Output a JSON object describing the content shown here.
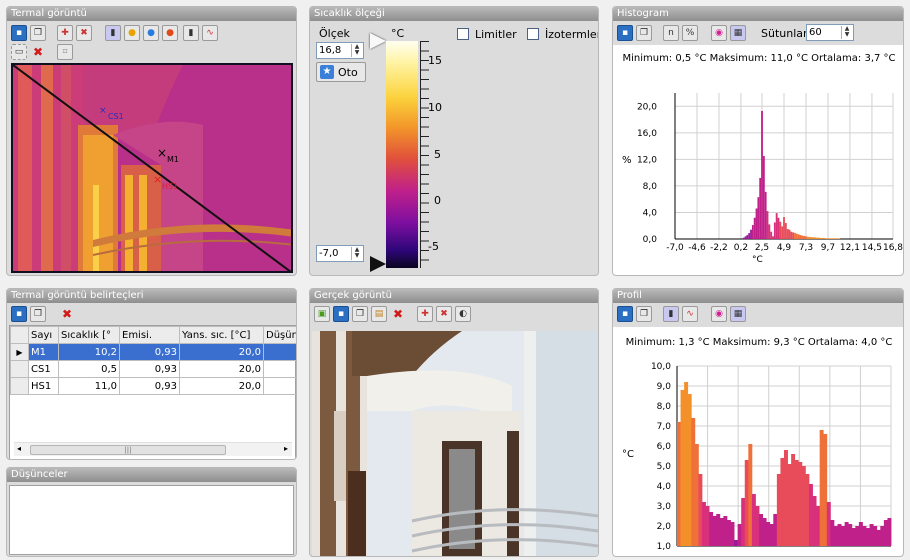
{
  "thermal": {
    "title": "Termal görüntü",
    "markers": [
      {
        "label": "CS1"
      },
      {
        "label": "M1"
      },
      {
        "label": "HS1"
      }
    ]
  },
  "scale": {
    "title": "Sıcaklık ölçeği",
    "olcek_label": "Ölçek",
    "max_value": "16,8",
    "min_value": "-7,0",
    "oto_label": "Oto",
    "unit": "°C",
    "limits_label": "Limitler",
    "isotherms_label": "İzotermler",
    "ticks": [
      "15",
      "10",
      "5",
      "0",
      "-5"
    ]
  },
  "histogram": {
    "title": "Histogram",
    "columns_label": "Sütunlar",
    "columns_value": "60",
    "stats": "Minimum: 0,5 °C Maksimum: 11,0 °C Ortalama: 3,7 °C",
    "ylabel": "%",
    "xlabel": "°C",
    "yticks": [
      "20,0",
      "16,0",
      "12,0",
      "8,0",
      "4,0",
      "0,0"
    ],
    "xticks": [
      "-7,0",
      "-4,6",
      "-2,2",
      "0,2",
      "2,5",
      "4,9",
      "7,3",
      "9,7",
      "12,1",
      "14,5",
      "16,8"
    ]
  },
  "markers_table": {
    "title": "Termal görüntü belirteçleri",
    "columns": [
      "Sayı",
      "Sıcaklık [°",
      "Emisi.",
      "Yans. sıc. [°C]",
      "Düşün"
    ],
    "rows": [
      [
        "M1",
        "10,2",
        "0,93",
        "20,0"
      ],
      [
        "CS1",
        "0,5",
        "0,93",
        "20,0"
      ],
      [
        "HS1",
        "11,0",
        "0,93",
        "20,0"
      ]
    ]
  },
  "notes": {
    "title": "Düşünceler",
    "text": ""
  },
  "real": {
    "title": "Gerçek görüntü"
  },
  "profile": {
    "title": "Profil",
    "stats": "Minimum: 1,3 °C Maksimum: 9,3 °C Ortalama: 4,0 °C",
    "ylabel": "°C",
    "yticks": [
      "10,0",
      "9,0",
      "8,0",
      "7,0",
      "6,0",
      "5,0",
      "4,0",
      "3,0",
      "2,0",
      "1,0"
    ]
  },
  "chart_data": [
    {
      "type": "bar",
      "title": "Histogram",
      "xlabel": "°C",
      "ylabel": "%",
      "xlim": [
        -7.0,
        16.8
      ],
      "ylim": [
        0,
        22
      ],
      "x": [
        0.5,
        0.7,
        0.9,
        1.1,
        1.3,
        1.5,
        1.7,
        1.9,
        2.1,
        2.3,
        2.5,
        2.7,
        2.9,
        3.1,
        3.3,
        3.5,
        3.7,
        3.9,
        4.1,
        4.3,
        4.5,
        4.7,
        4.9,
        5.1,
        5.3,
        5.5,
        5.7,
        5.9,
        6.1,
        6.3,
        6.5,
        6.7,
        6.9,
        7.1,
        7.3,
        7.5,
        7.7,
        7.9,
        8.1,
        8.3,
        8.5,
        8.7,
        8.9,
        9.1,
        9.3,
        9.5,
        9.7,
        9.9,
        10.1,
        10.3,
        10.5,
        10.7,
        10.9
      ],
      "values": [
        0.2,
        0.4,
        0.6,
        0.9,
        1.4,
        2.1,
        3.2,
        4.6,
        6.3,
        9.2,
        19.3,
        12.5,
        7.1,
        4.2,
        2.2,
        1.1,
        0.4,
        2.5,
        3.9,
        3.2,
        2.6,
        1.9,
        3.3,
        2.4,
        1.5,
        1.4,
        1.1,
        1.0,
        0.9,
        0.8,
        0.7,
        0.6,
        0.5,
        0.45,
        0.4,
        0.35,
        0.3,
        0.3,
        0.25,
        0.25,
        0.2,
        0.2,
        0.15,
        0.15,
        0.15,
        0.1,
        0.1,
        0.1,
        0.1,
        0.1,
        0.1,
        0.1,
        0.1
      ]
    },
    {
      "type": "area",
      "title": "Profil",
      "ylabel": "°C",
      "ylim": [
        1.0,
        10.0
      ],
      "values": [
        7.2,
        8.8,
        9.2,
        8.6,
        7.4,
        6.1,
        4.6,
        3.2,
        3.0,
        2.7,
        2.5,
        2.6,
        2.4,
        2.5,
        2.3,
        2.2,
        1.3,
        2.1,
        3.4,
        5.3,
        6.1,
        3.6,
        3.0,
        2.6,
        2.4,
        2.2,
        2.1,
        2.6,
        4.6,
        5.4,
        5.8,
        5.1,
        5.6,
        5.3,
        5.2,
        5.0,
        4.6,
        4.1,
        3.5,
        3.0,
        6.8,
        6.6,
        3.2,
        2.3,
        2.0,
        2.1,
        2.0,
        2.2,
        2.1,
        1.9,
        2.0,
        2.2,
        2.0,
        1.9,
        2.1,
        2.0,
        1.8,
        2.0,
        2.3,
        2.4
      ]
    }
  ]
}
